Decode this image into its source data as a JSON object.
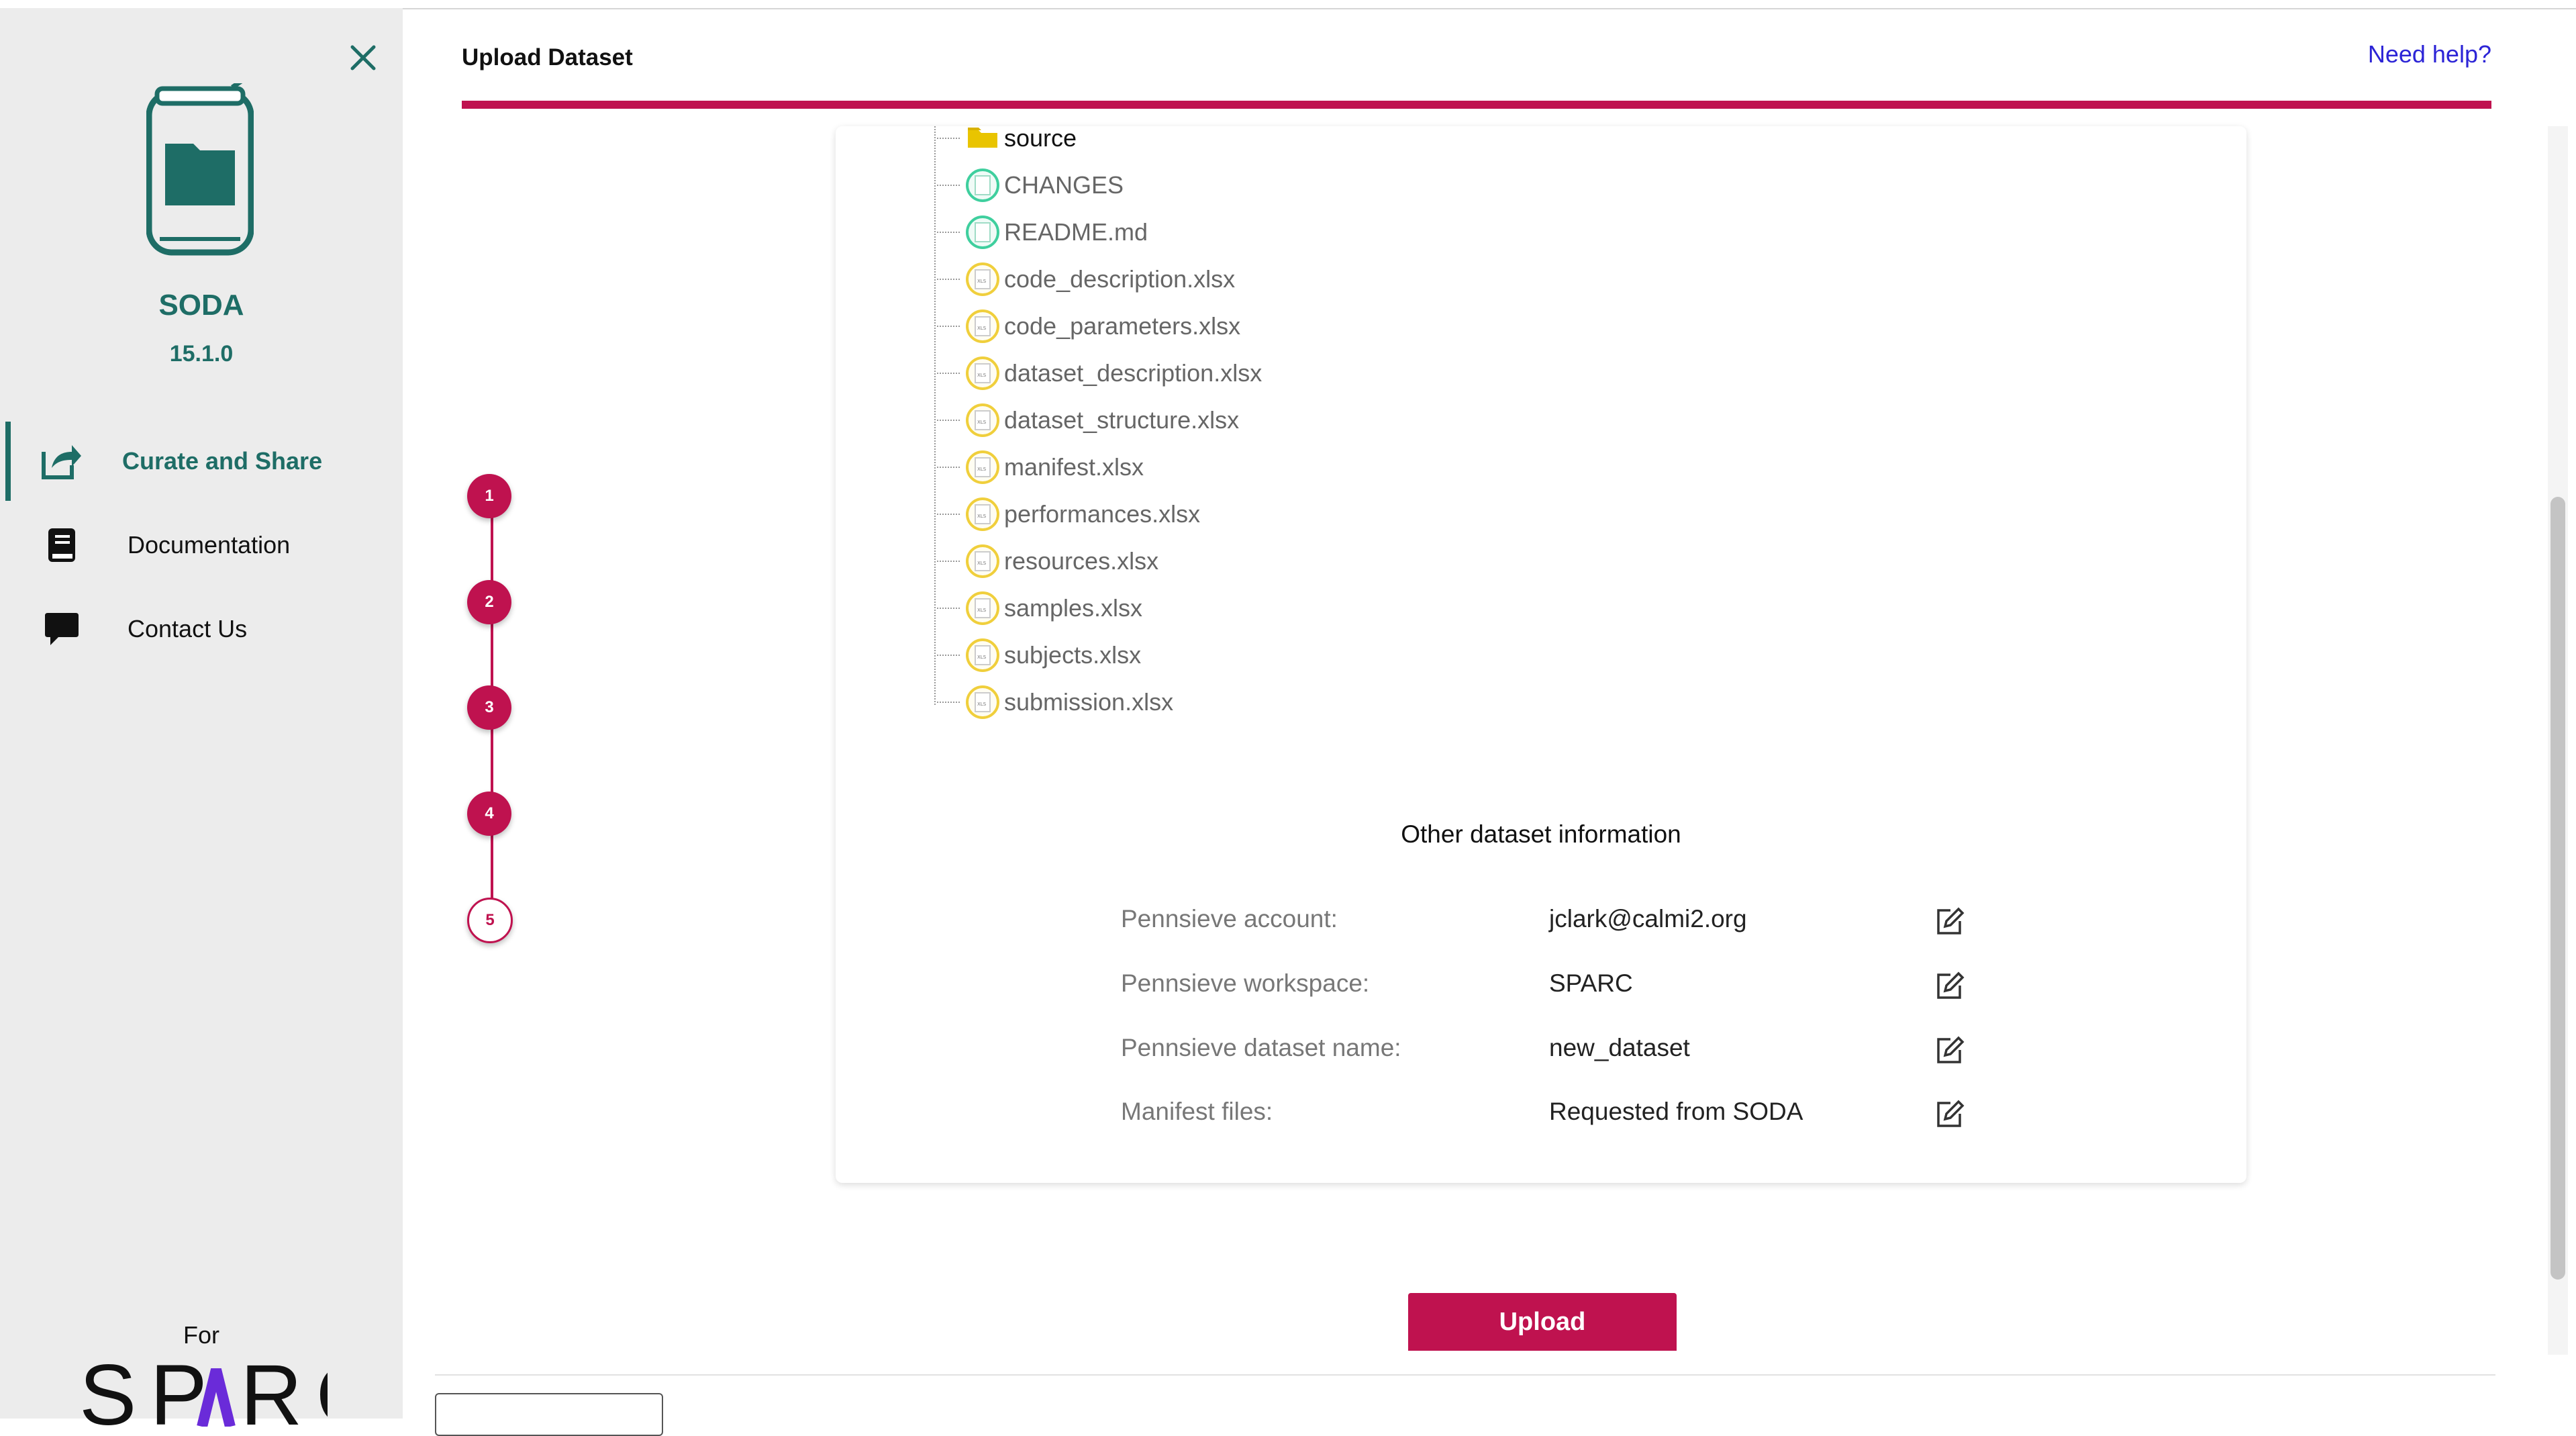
{
  "app": {
    "name": "SODA",
    "version": "15.1.0"
  },
  "sidebar": {
    "items": [
      {
        "label": "Curate and Share",
        "icon": "share-icon",
        "active": true
      },
      {
        "label": "Documentation",
        "icon": "book-icon",
        "active": false
      },
      {
        "label": "Contact Us",
        "icon": "chat-bubble-icon",
        "active": false
      }
    ],
    "footer_for": "For",
    "footer_brand": "SPARC"
  },
  "header": {
    "title": "Upload Dataset",
    "help_link": "Need help?"
  },
  "stepper": {
    "steps": [
      "1",
      "2",
      "3",
      "4",
      "5"
    ],
    "current_step": 5
  },
  "tree": {
    "items": [
      {
        "name": "source",
        "type": "folder"
      },
      {
        "name": "CHANGES",
        "type": "text"
      },
      {
        "name": "README.md",
        "type": "text"
      },
      {
        "name": "code_description.xlsx",
        "type": "xlsx"
      },
      {
        "name": "code_parameters.xlsx",
        "type": "xlsx"
      },
      {
        "name": "dataset_description.xlsx",
        "type": "xlsx"
      },
      {
        "name": "dataset_structure.xlsx",
        "type": "xlsx"
      },
      {
        "name": "manifest.xlsx",
        "type": "xlsx"
      },
      {
        "name": "performances.xlsx",
        "type": "xlsx"
      },
      {
        "name": "resources.xlsx",
        "type": "xlsx"
      },
      {
        "name": "samples.xlsx",
        "type": "xlsx"
      },
      {
        "name": "subjects.xlsx",
        "type": "xlsx"
      },
      {
        "name": "submission.xlsx",
        "type": "xlsx"
      }
    ]
  },
  "info": {
    "title": "Other dataset information",
    "rows": [
      {
        "label": "Pennsieve account:",
        "value": "jclark@calmi2.org"
      },
      {
        "label": "Pennsieve workspace:",
        "value": "SPARC"
      },
      {
        "label": "Pennsieve dataset name:",
        "value": "new_dataset"
      },
      {
        "label": "Manifest files:",
        "value": "Requested from SODA"
      }
    ]
  },
  "actions": {
    "upload_label": "Upload"
  },
  "colors": {
    "brand_teal": "#1e6d66",
    "accent_crimson": "#bf124f",
    "link_blue": "#2c24d6",
    "sparc_purple": "#6a2bd9"
  }
}
